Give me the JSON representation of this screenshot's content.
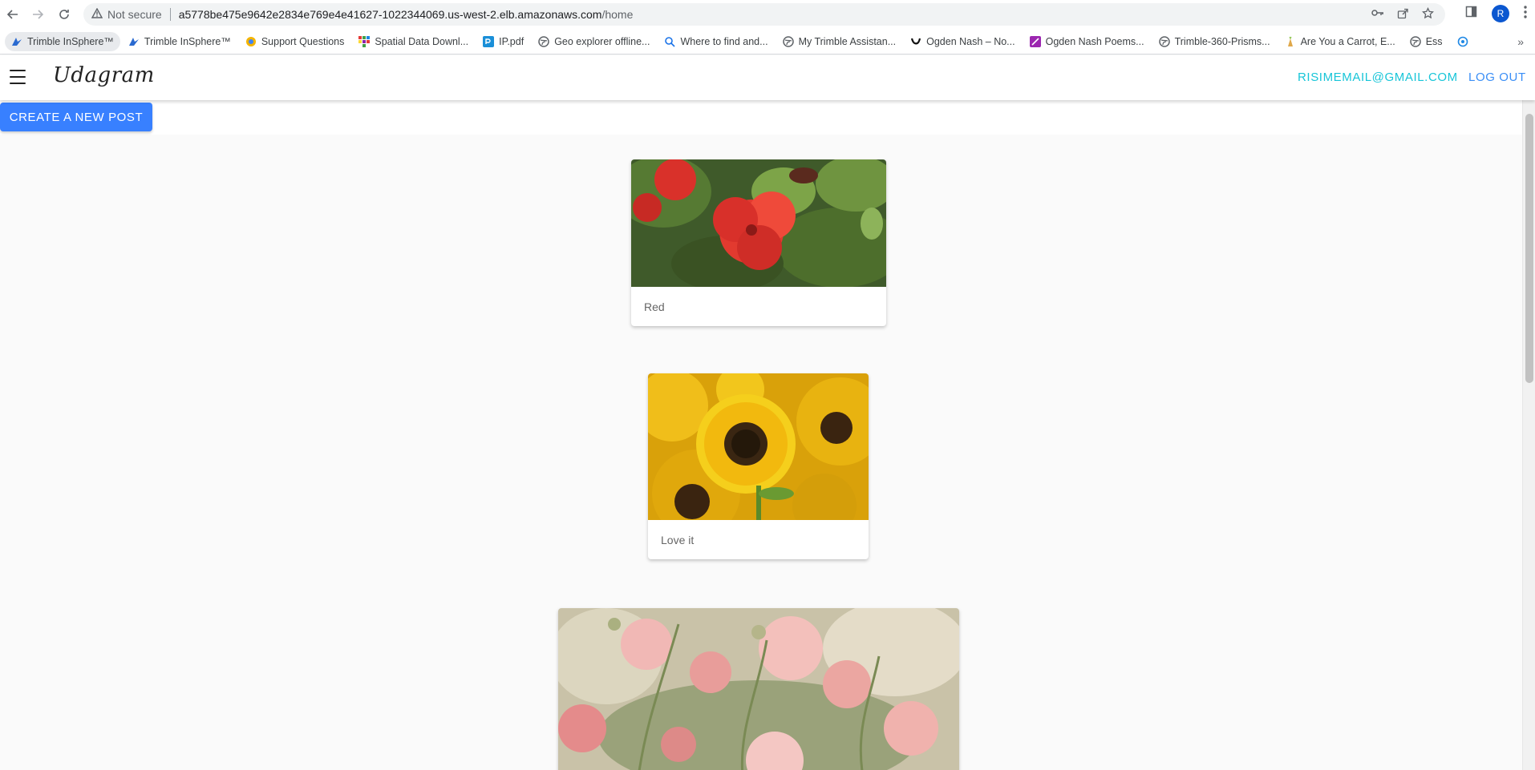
{
  "browser": {
    "not_secure_label": "Not secure",
    "url_host": "a5778be475e9642e2834e769e4e41627-1022344069.us-west-2.elb.amazonaws.com",
    "url_path": "/home",
    "profile_initial": "R",
    "bookmarks": [
      {
        "label": "Trimble InSphere™",
        "icon": "trimble-icon"
      },
      {
        "label": "Trimble InSphere™",
        "icon": "trimble-icon"
      },
      {
        "label": "Support Questions",
        "icon": "support-icon"
      },
      {
        "label": "Spatial Data Downl...",
        "icon": "grid-icon"
      },
      {
        "label": "IP.pdf",
        "icon": "pdf-icon"
      },
      {
        "label": "Geo explorer offline...",
        "icon": "globe-icon"
      },
      {
        "label": "Where to find and...",
        "icon": "search-icon"
      },
      {
        "label": "My Trimble Assistan...",
        "icon": "globe-icon"
      },
      {
        "label": "Ogden Nash – No...",
        "icon": "nash-icon"
      },
      {
        "label": "Ogden Nash Poems...",
        "icon": "quill-icon"
      },
      {
        "label": "Trimble-360-Prisms...",
        "icon": "globe-icon"
      },
      {
        "label": "Are You a Carrot, E...",
        "icon": "carrot-icon"
      },
      {
        "label": "Ess",
        "icon": "globe-icon"
      }
    ]
  },
  "app": {
    "logo": "Udagram",
    "user_email": "RISIMEMAIL@GMAIL.COM",
    "logout_label": "LOG OUT",
    "create_post_label": "CREATE A NEW POST"
  },
  "posts": [
    {
      "caption": "Red",
      "image": "red-hibiscus-photo"
    },
    {
      "caption": "Love it",
      "image": "sunflower-photo"
    },
    {
      "caption": "",
      "image": "pink-dahlias-photo"
    }
  ],
  "colors": {
    "accent_email": "#17c5d8",
    "accent_logout": "#3a8ef6",
    "button_blue": "#3880ff"
  }
}
